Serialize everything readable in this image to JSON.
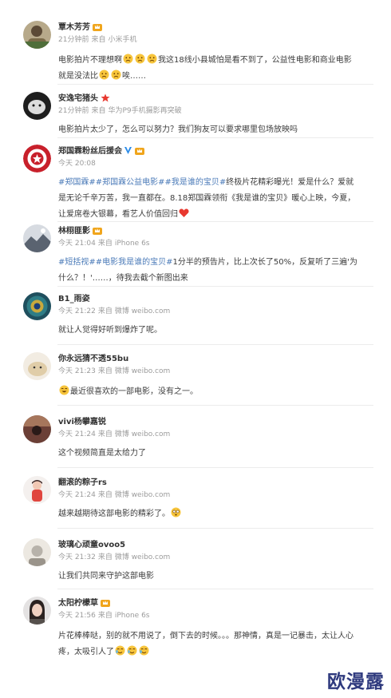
{
  "comments": [
    {
      "user": "覃木芳芳",
      "time": "21分钟前",
      "from": "来自",
      "source": "小米手机",
      "text": {
        "p1": "电影拍片不理想啊",
        "p2": "我这18线小县城怕是看不到了，公益性电影和商业电影就是没法比",
        "p3": "唉……"
      }
    },
    {
      "user": "安逸宅猪头",
      "time": "21分钟前",
      "from": "来自",
      "source": "华为P9手机摄影再突破",
      "text": "电影拍片太少了，怎么可以努力？我们狗友可以要求哪里包场放映吗"
    },
    {
      "user": "郑国霖粉丝后援会",
      "time": "今天 20:08",
      "text": {
        "tag1": "#郑国霖#",
        "tag2": "#郑国霖公益电影#",
        "tag3": "#我是谁的宝贝#",
        "body": "终极片花精彩曝光！爱是什么？爱就是无论千辛万苦，我一直都在。8.18郑国霖领衔《我是谁的宝贝》暖心上映，今夏，让爱席卷大银幕，看艺人价值回归"
      }
    },
    {
      "user": "林栩匪影",
      "time": "今天 21:04",
      "from": "来自",
      "source": "iPhone 6s",
      "text": {
        "tag1": "#短括视#",
        "tag2": "#电影我是谁的宝贝#",
        "body": "1分半的预告片，比上次长了50%，反复听了三遍'为什么？！'……，待我去截个新图出来"
      }
    },
    {
      "user": "B1_雨姿",
      "time": "今天 21:22",
      "from": "来自",
      "source": "微博 weibo.com",
      "text": "就让人觉得好听到爆炸了呢。"
    },
    {
      "user": "你永远猜不透55bu",
      "time": "今天 21:23",
      "from": "来自",
      "source": "微博 weibo.com",
      "text": "最近很喜欢的一部电影，没有之一。"
    },
    {
      "user": "vivi杨攀嘉锐",
      "time": "今天 21:24",
      "from": "来自",
      "source": "微博 weibo.com",
      "text": "这个视频简直是太给力了"
    },
    {
      "user": "翻滚的粽子rs",
      "time": "今天 21:24",
      "from": "来自",
      "source": "微博 weibo.com",
      "text": "越来越期待这部电影的精彩了。"
    },
    {
      "user": "玻璃心顽童ovoo5",
      "time": "今天 21:32",
      "from": "来自",
      "source": "微博 weibo.com",
      "text": "让我们共同来守护这部电影"
    },
    {
      "user": "太阳柠檬草",
      "time": "今天 21:56",
      "from": "来自",
      "source": "iPhone 6s",
      "text": "片花棒棒哒，别的就不用说了，倒下去的时候。。。那神情，真是一记暴击，太让人心疼，太吸引人了"
    }
  ],
  "watermark": "欧漫露",
  "colors": {
    "tag": "#4a7ab8",
    "meta": "#9b9b9b",
    "watermark": "#2f3a7e",
    "badge": "#f0a51c",
    "verified": "#2a8be8"
  },
  "icons": {
    "badge": "crown-badge-icon",
    "verified": "verified-v-icon",
    "star": "star-icon",
    "emoji": "emoji-icon"
  }
}
